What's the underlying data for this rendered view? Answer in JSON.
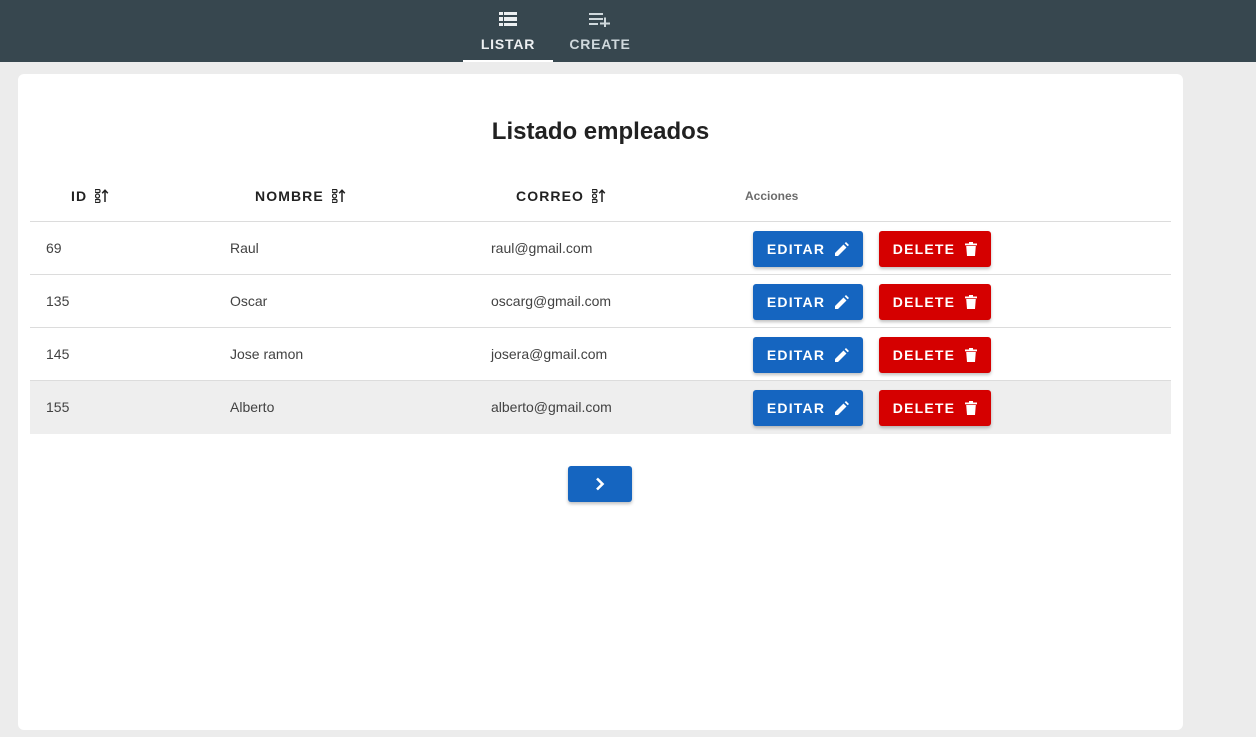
{
  "nav": {
    "tabs": [
      {
        "label": "LISTAR",
        "icon": "list-icon",
        "active": true
      },
      {
        "label": "CREATE",
        "icon": "playlist-add-icon",
        "active": false
      }
    ]
  },
  "main": {
    "title": "Listado empleados",
    "columns": [
      {
        "label": "ID",
        "sortable": true
      },
      {
        "label": "NOMBRE",
        "sortable": true
      },
      {
        "label": "CORREO",
        "sortable": true
      },
      {
        "label": "Acciones",
        "sortable": false
      }
    ],
    "rows": [
      {
        "id": "69",
        "nombre": "Raul",
        "correo": "raul@gmail.com"
      },
      {
        "id": "135",
        "nombre": "Oscar",
        "correo": "oscarg@gmail.com"
      },
      {
        "id": "145",
        "nombre": "Jose ramon",
        "correo": "josera@gmail.com"
      },
      {
        "id": "155",
        "nombre": "Alberto",
        "correo": "alberto@gmail.com"
      }
    ],
    "edit_label": "EDITAR",
    "delete_label": "DELETE",
    "pagination": {
      "next_icon": "chevron-right-icon"
    }
  },
  "colors": {
    "topbar": "#37474f",
    "primary": "#1565c0",
    "danger": "#d50000",
    "background": "#ececec"
  }
}
